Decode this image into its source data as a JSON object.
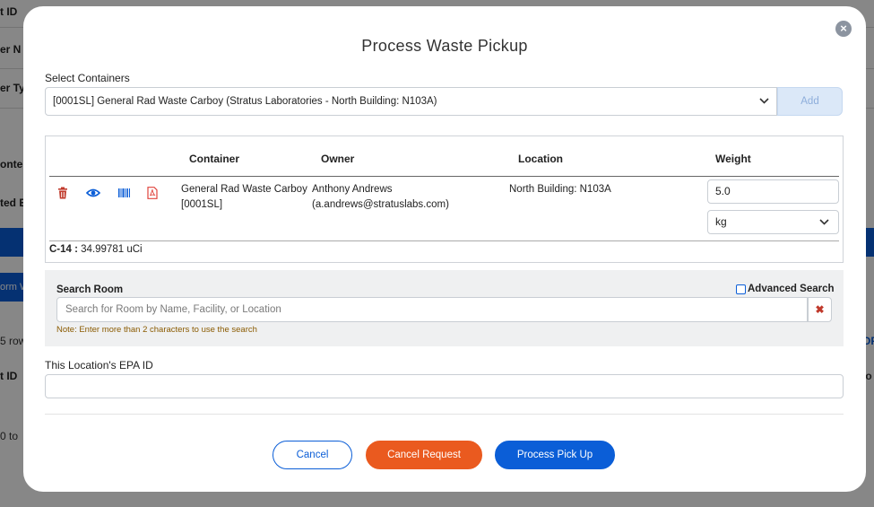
{
  "background": {
    "labels": [
      "t ID",
      "er N",
      "er Ty",
      "onter",
      "ted E",
      "t ID"
    ],
    "form_button": "orm W",
    "rows_text": "5 row",
    "paging_text": "0 to",
    "right_text": "OF",
    "right_id": "Io"
  },
  "modal": {
    "title": "Process Waste Pickup",
    "close_label": "×"
  },
  "select_containers": {
    "label": "Select Containers",
    "value": "[0001SL] General Rad Waste Carboy (Stratus Laboratories - North Building: N103A)",
    "add_label": "Add"
  },
  "table": {
    "headers": {
      "container": "Container",
      "owner": "Owner",
      "location": "Location",
      "weight": "Weight"
    },
    "row": {
      "container_name": "General Rad Waste Carboy",
      "container_id": "[0001SL]",
      "owner_name": "Anthony Andrews",
      "owner_email": "(a.andrews@stratuslabs.com)",
      "location": "North Building: N103A",
      "weight_value": "5.0",
      "weight_unit": "kg"
    },
    "isotope_label": "C-14 :",
    "isotope_value": "34.99781 uCi",
    "icons": [
      "trash-icon",
      "eye-icon",
      "barcode-icon",
      "pdf-icon"
    ]
  },
  "search_room": {
    "label": "Search Room",
    "placeholder": "Search for Room by Name, Facility, or Location",
    "note": "Note: Enter more than 2 characters to use the search",
    "advanced_label": "Advanced Search",
    "clear_label": "✖"
  },
  "epa": {
    "label": "This Location's EPA ID",
    "value": ""
  },
  "buttons": {
    "cancel": "Cancel",
    "cancel_request": "Cancel Request",
    "process": "Process Pick Up"
  },
  "colors": {
    "primary": "#0b5ed7",
    "danger": "#ea5a1f",
    "icon_red": "#c0392b",
    "add_disabled": "#dbe8f8"
  }
}
